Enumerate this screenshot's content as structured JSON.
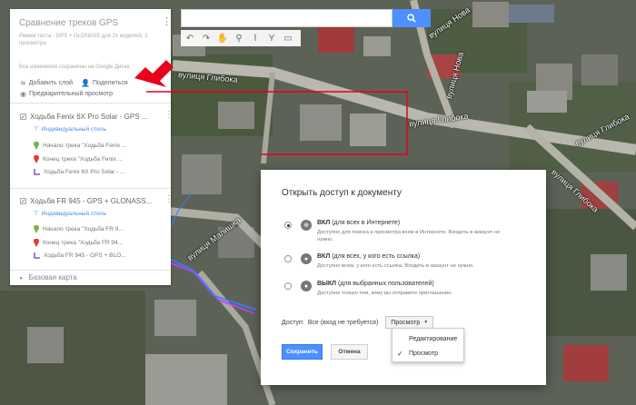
{
  "map": {
    "streets": [
      {
        "id": "glybokа",
        "label": "вулиця Глибока"
      },
      {
        "id": "glybokа2",
        "label": "вулиця Глибока"
      },
      {
        "id": "glybokа3",
        "label": "вулиця Глибока"
      },
      {
        "id": "glybokа4",
        "label": "вулиця Глибока"
      },
      {
        "id": "nova",
        "label": "вулиця Нова"
      },
      {
        "id": "nova2",
        "label": "вулиця Нова"
      },
      {
        "id": "malysha",
        "label": "вулиця Малишка"
      }
    ]
  },
  "search": {
    "placeholder": ""
  },
  "panel": {
    "title": "Сравнение треков GPS",
    "description": "Режим теста - GPS + GLONASS для 2х моделей, 3 просмотра",
    "saved_status": "Все изменения сохранены на Google Диске",
    "add_layer": "Добавить слой",
    "share": "Поделиться",
    "preview": "Предварительный просмотр",
    "layers": [
      {
        "title": "Ходьба Fenix 6X Pro Solar - GPS ...",
        "style": "Индивидуальный стиль",
        "features": [
          {
            "label": "Начало трека \"Ходьба Fenix ...",
            "color": "#7cb342",
            "kind": "pin"
          },
          {
            "label": "Конец трека \"Ходьба Fenix ...",
            "color": "#e53935",
            "kind": "pin"
          },
          {
            "label": "Ходьба Fenix 6X Pro Solar - ...",
            "color": "#7e57c2",
            "kind": "line"
          }
        ]
      },
      {
        "title": "Ходьба FR 945 - GPS + GLONASS...",
        "style": "Индивидуальный стиль",
        "features": [
          {
            "label": "Начало трека \"Ходьба FR 9...",
            "color": "#7cb342",
            "kind": "pin"
          },
          {
            "label": "Конец трека \"Ходьба FR 94...",
            "color": "#e53935",
            "kind": "pin"
          },
          {
            "label": "Ходьба FR 945 - GPS + BLO...",
            "color": "#7e57c2",
            "kind": "line"
          }
        ]
      }
    ],
    "basemap": "Базовая карта"
  },
  "dialog": {
    "title": "Открыть доступ к документу",
    "options": [
      {
        "head_bold": "ВКЛ",
        "head_rest": " (для всех в Интернете)",
        "desc": "Доступно для поиска и просмотра всем в Интернете. Входить в аккаунт не нужно.",
        "icon": "globe-icon",
        "selected": true
      },
      {
        "head_bold": "ВКЛ",
        "head_rest": " (для всех, у кого есть ссылка)",
        "desc": "Доступно всем, у кого есть ссылка. Входить в аккаунт не нужно.",
        "icon": "person-link-icon",
        "selected": false
      },
      {
        "head_bold": "ВЫКЛ",
        "head_rest": " (для выбранных пользователей)",
        "desc": "Доступно только тем, кому вы отправите приглашение.",
        "icon": "person-icon",
        "selected": false
      }
    ],
    "access_label": "Доступ:",
    "access_value": "Все (вход не требуется)",
    "dropdown_value": "Просмотр",
    "dropdown_options": [
      "Редактирование",
      "Просмотр"
    ],
    "dropdown_selected": "Просмотр",
    "save": "Сохранить",
    "cancel": "Отмена"
  },
  "colors": {
    "accent": "#4d90fe",
    "annotation": "#e8001c"
  }
}
